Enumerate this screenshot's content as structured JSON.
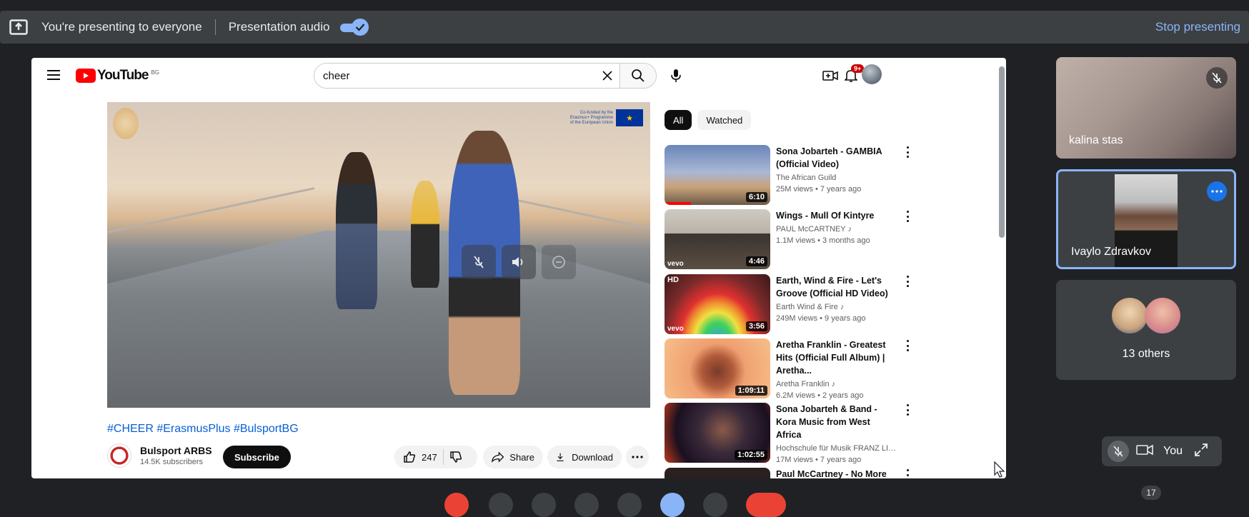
{
  "meet": {
    "presenting_text": "You're presenting to everyone",
    "audio_label": "Presentation audio",
    "stop_label": "Stop presenting",
    "participants_count": "17",
    "accent_color": "#8ab4f8"
  },
  "youtube": {
    "logo_text": "YouTube",
    "country_code": "BG",
    "search_value": "cheer",
    "notification_badge": "9+",
    "video": {
      "eu_text_1": "Co-funded by the",
      "eu_text_2": "Erasmus+ Programme",
      "eu_text_3": "of the European Union",
      "title": "#CHEER #ErasmusPlus #BulsportBG",
      "channel": "Bulsport ARBS",
      "subscribers": "14.5K subscribers",
      "subscribe_label": "Subscribe",
      "likes": "247",
      "share_label": "Share",
      "download_label": "Download"
    },
    "chips": [
      "All",
      "Watched"
    ],
    "recommendations": [
      {
        "title": "Sona Jobarteh - GAMBIA (Official Video)",
        "channel": "The African Guild",
        "meta": "25M views • 7 years ago",
        "duration": "6:10",
        "watched": 0.25
      },
      {
        "title": "Wings - Mull Of Kintyre",
        "channel": "PAUL McCARTNEY ♪",
        "meta": "1.1M views • 3 months ago",
        "duration": "4:46",
        "watched": 0
      },
      {
        "title": "Earth, Wind & Fire - Let's Groove (Official HD Video)",
        "channel": "Earth Wind & Fire ♪",
        "meta": "249M views • 9 years ago",
        "duration": "3:56",
        "watched": 0
      },
      {
        "title": "Aretha Franklin - Greatest Hits (Official Full Album) | Aretha...",
        "channel": "Aretha Franklin ♪",
        "meta": "6.2M views • 2 years ago",
        "duration": "1:09:11",
        "watched": 0
      },
      {
        "title": "Sona Jobarteh & Band - Kora Music from West Africa",
        "channel": "Hochschule für Musik FRANZ LISZT ...",
        "meta": "17M views • 7 years ago",
        "duration": "1:02:55",
        "watched": 0
      },
      {
        "title": "Paul McCartney - No More",
        "channel": "",
        "meta": "",
        "duration": "",
        "watched": 0
      }
    ],
    "thumb_badges": {
      "vevo": "vevo",
      "hd": "HD"
    }
  },
  "tiles": [
    {
      "name": "kalina stas"
    },
    {
      "name": "Ivaylo Zdravkov"
    },
    {
      "name": "13 others"
    }
  ],
  "self_view_label": "You"
}
